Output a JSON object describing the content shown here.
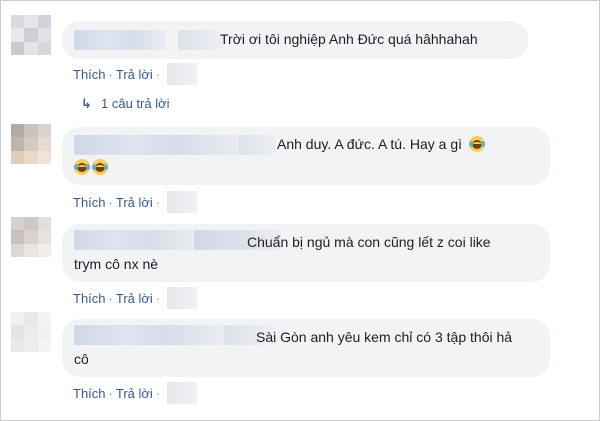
{
  "comments": [
    {
      "text_lines": [
        "Trời ơi tôi nghiệp Anh Đức quá hâhhahah"
      ],
      "actions": {
        "like": "Thích",
        "reply": "Trả lời"
      },
      "replies_link": "1 câu trả lời"
    },
    {
      "text_lines": [
        "Anh duy. A đức. A tú. Hay a gì"
      ],
      "emoji": "face-with-tears-of-joy-icon",
      "actions": {
        "like": "Thích",
        "reply": "Trả lời"
      }
    },
    {
      "text_lines": [
        "Chuẩn bị ngủ mà con cũng lết z coi like",
        "trym cô nx nè"
      ],
      "actions": {
        "like": "Thích",
        "reply": "Trả lời"
      }
    },
    {
      "text_lines": [
        "Sài Gòn anh yêu kem chỉ có 3 tập thôi hả",
        "cô"
      ],
      "actions": {
        "like": "Thích",
        "reply": "Trả lời"
      }
    }
  ],
  "colors": {
    "bubble": "#f2f3f5",
    "link": "#385898",
    "text": "#1c1e21",
    "emoji": "#ffcc4d"
  }
}
